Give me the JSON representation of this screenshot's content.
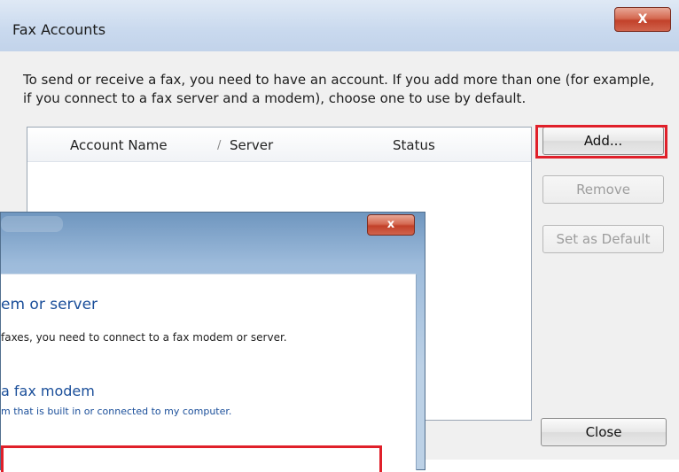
{
  "fax_accounts": {
    "title": "Fax Accounts",
    "description": "To send or receive a fax, you need to have an account. If you add more than one (for example, if you connect to a fax server and a modem), choose one to use by default.",
    "columns": {
      "name": "Account Name",
      "sort_indicator": "/",
      "server": "Server",
      "status": "Status"
    },
    "buttons": {
      "add": "Add...",
      "remove": "Remove",
      "set_default": "Set as Default",
      "close": "Close"
    },
    "close_glyph": "X"
  },
  "fax_setup": {
    "close_glyph": "x",
    "heading": "em or server",
    "intro": "faxes, you need to connect to a fax modem or server.",
    "option1_title": "a fax modem",
    "option1_desc": "m that is built in or connected to my computer."
  },
  "colors": {
    "highlight": "#e0202a",
    "link_blue": "#1b4f9a"
  }
}
